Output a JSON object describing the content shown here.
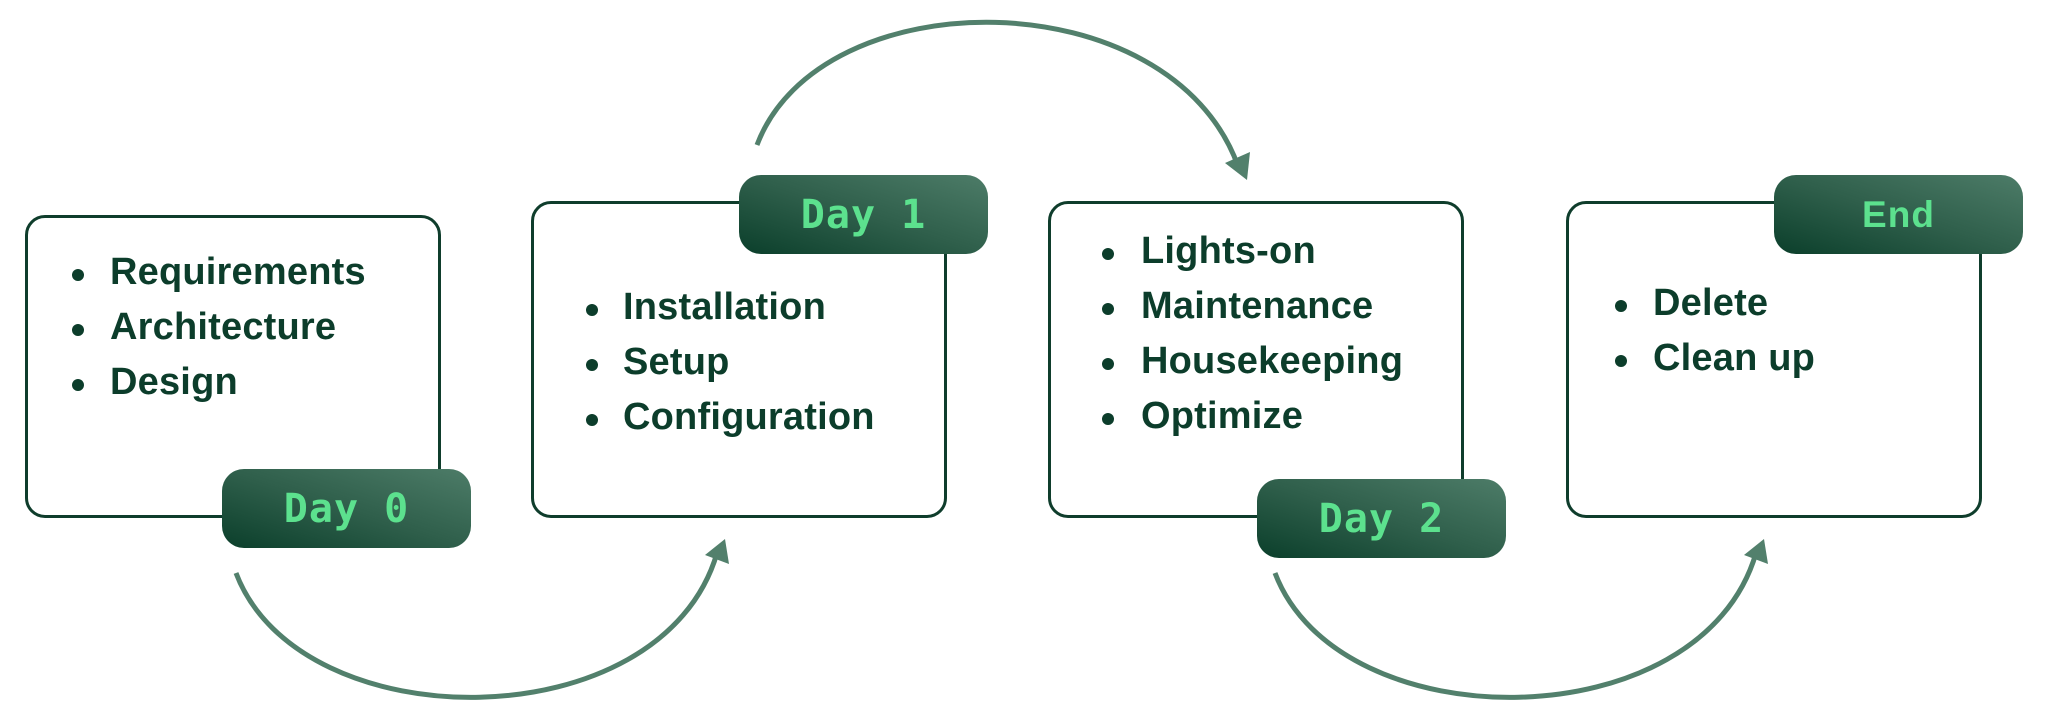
{
  "diagram": {
    "type": "lifecycle-flow",
    "colors": {
      "text": "#0c3d2b",
      "box_border": "#0f3d2c",
      "badge_gradient_start": "#0b3f2b",
      "badge_gradient_end": "#4d7c68",
      "badge_text": "#5ce18e",
      "arrow": "#52806c"
    },
    "stages": [
      {
        "badge": "Day 0",
        "items": [
          "Requirements",
          "Architecture",
          "Design"
        ]
      },
      {
        "badge": "Day 1",
        "items": [
          "Installation",
          "Setup",
          "Configuration"
        ]
      },
      {
        "badge": "Day 2",
        "items": [
          "Lights-on",
          "Maintenance",
          "Housekeeping",
          "Optimize"
        ]
      },
      {
        "badge": "End",
        "items": [
          "Delete",
          "Clean up"
        ]
      }
    ],
    "arrows": [
      {
        "from": "Day 0",
        "to": "Day 1",
        "direction": "below"
      },
      {
        "from": "Day 1",
        "to": "Day 2",
        "direction": "above"
      },
      {
        "from": "Day 2",
        "to": "End",
        "direction": "below"
      }
    ]
  }
}
